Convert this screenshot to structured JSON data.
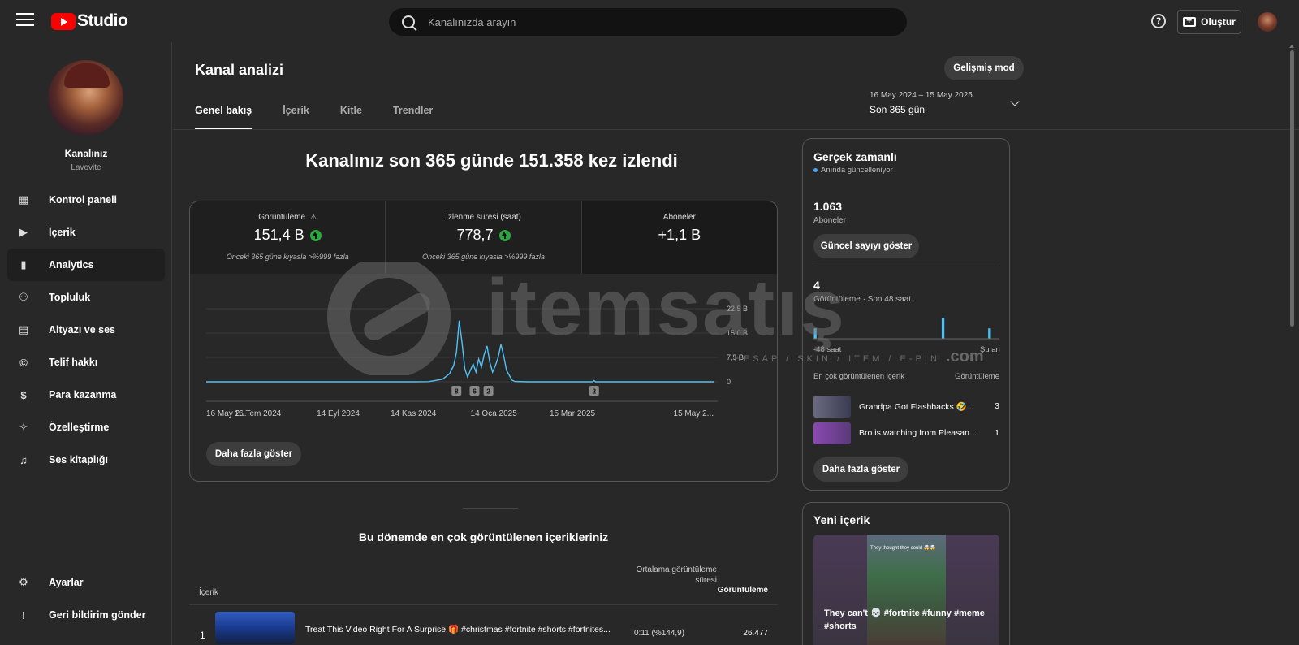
{
  "app": {
    "logo_text": "Studio"
  },
  "search": {
    "placeholder": "Kanalınızda arayın"
  },
  "header": {
    "help_glyph": "?",
    "create_label": "Oluştur"
  },
  "channel": {
    "name": "Kanalınız",
    "handle": "Lavovite"
  },
  "sidebar": {
    "items": [
      {
        "label": "Kontrol paneli",
        "icon": "dashboard-icon",
        "glyph": "▦"
      },
      {
        "label": "İçerik",
        "icon": "content-icon",
        "glyph": "▶"
      },
      {
        "label": "Analytics",
        "icon": "analytics-icon",
        "glyph": "▮",
        "active": true
      },
      {
        "label": "Topluluk",
        "icon": "community-icon",
        "glyph": "⚇"
      },
      {
        "label": "Altyazı ve ses",
        "icon": "subtitles-icon",
        "glyph": "▤"
      },
      {
        "label": "Telif hakkı",
        "icon": "copyright-icon",
        "glyph": "©"
      },
      {
        "label": "Para kazanma",
        "icon": "monetization-icon",
        "glyph": "$"
      },
      {
        "label": "Özelleştirme",
        "icon": "customization-icon",
        "glyph": "✧"
      },
      {
        "label": "Ses kitaplığı",
        "icon": "audio-library-icon",
        "glyph": "♫"
      }
    ],
    "bottom": [
      {
        "label": "Ayarlar",
        "icon": "settings-icon",
        "glyph": "⚙"
      },
      {
        "label": "Geri bildirim gönder",
        "icon": "feedback-icon",
        "glyph": "!"
      }
    ]
  },
  "page": {
    "title": "Kanal analizi",
    "advanced_mode": "Gelişmiş mod",
    "tabs": [
      {
        "label": "Genel bakış",
        "active": true
      },
      {
        "label": "İçerik"
      },
      {
        "label": "Kitle"
      },
      {
        "label": "Trendler"
      }
    ],
    "date_range": {
      "dates": "16 May 2024 – 15 May 2025",
      "label": "Son 365 gün"
    },
    "headline": "Kanalınız son 365 günde 151.358 kez izlendi"
  },
  "metrics": {
    "views": {
      "label": "Görüntüleme",
      "value": "151,4 B",
      "note": "Önceki 365 güne kıyasla >%999 fazla",
      "warning_glyph": "⚠"
    },
    "watch_time": {
      "label": "İzlenme süresi (saat)",
      "value": "778,7",
      "note": "Önceki 365 güne kıyasla >%999 fazla"
    },
    "subscribers": {
      "label": "Aboneler",
      "value": "+1,1 B"
    }
  },
  "chart_data": {
    "type": "line",
    "y_ticks": [
      "22,5 B",
      "15,0 B",
      "7,5 B",
      "0"
    ],
    "ylim": [
      0,
      22500
    ],
    "x_ticks": [
      "16 May 2...",
      "16 Tem 2024",
      "14 Eyl 2024",
      "14 Kas 2024",
      "14 Oca 2025",
      "15 Mar 2025",
      "15 May 2..."
    ],
    "series": [
      {
        "color": "#4fc3f7",
        "points": [
          [
            0,
            0
          ],
          [
            150,
            0
          ],
          [
            160,
            50
          ],
          [
            170,
            800
          ],
          [
            175,
            2500
          ],
          [
            178,
            5000
          ],
          [
            180,
            9000
          ],
          [
            182,
            18800
          ],
          [
            184,
            12000
          ],
          [
            186,
            4000
          ],
          [
            188,
            1500
          ],
          [
            190,
            3500
          ],
          [
            192,
            5500
          ],
          [
            194,
            3000
          ],
          [
            196,
            7000
          ],
          [
            198,
            4500
          ],
          [
            200,
            8500
          ],
          [
            202,
            11000
          ],
          [
            204,
            6000
          ],
          [
            206,
            3000
          ],
          [
            208,
            5000
          ],
          [
            210,
            7500
          ],
          [
            212,
            11500
          ],
          [
            214,
            8000
          ],
          [
            216,
            3500
          ],
          [
            218,
            2000
          ],
          [
            220,
            500
          ],
          [
            222,
            100
          ],
          [
            232,
            0
          ],
          [
            278,
            0
          ],
          [
            279,
            400
          ],
          [
            280,
            0
          ],
          [
            365,
            0
          ]
        ]
      }
    ],
    "annotations": [
      {
        "x": 180,
        "label": "8"
      },
      {
        "x": 193,
        "label": "6"
      },
      {
        "x": 203,
        "label": "2"
      },
      {
        "x": 279,
        "label": "2"
      }
    ],
    "grid": true
  },
  "overview_more": "Daha fazla göster",
  "top_content": {
    "title": "Bu dönemde en çok görüntülenen içerikleriniz",
    "headers": {
      "content": "İçerik",
      "avg_duration": "Ortalama görüntüleme süresi",
      "views": "Görüntüleme"
    },
    "rows": [
      {
        "rank": "1",
        "title": "Treat This Video Right For A Surprise 🎁 #christmas #fortnite #shorts #fortnites...",
        "avg": "0:11   (%144,9)",
        "views": "26.477"
      }
    ]
  },
  "realtime": {
    "title": "Gerçek zamanlı",
    "live_text": "Anında güncelleniyor",
    "subscribers_value": "1.063",
    "subscribers_label": "Aboneler",
    "show_count": "Güncel sayıyı göster",
    "views_value": "4",
    "views_label": "Görüntüleme · Son 48 saat",
    "bars": [
      1,
      0,
      0,
      0,
      0,
      0,
      0,
      0,
      0,
      0,
      0,
      0,
      0,
      0,
      0,
      0,
      0,
      0,
      0,
      0,
      0,
      0,
      0,
      0,
      0,
      0,
      0,
      0,
      0,
      0,
      0,
      0,
      0,
      2,
      0,
      0,
      0,
      0,
      0,
      0,
      0,
      0,
      0,
      0,
      0,
      1,
      0,
      0
    ],
    "axis_left": "-48 saat",
    "axis_right": "Şu an",
    "top_header": "En çok görüntülenen içerik",
    "top_views_header": "Görüntüleme",
    "items": [
      {
        "title": "Grandpa Got Flashbacks 🤣...",
        "views": "3",
        "thumb": "#5a5a6a"
      },
      {
        "title": "Bro is watching from Pleasan...",
        "views": "1",
        "thumb": "#7a4a8a"
      }
    ],
    "more": "Daha fazla göster"
  },
  "new_content": {
    "title": "Yeni içerik",
    "thumb_caption": "They thought they could 🤯🤯",
    "video_title": "They can't 💀 #fortnite #funny #meme #shorts"
  },
  "watermark": {
    "text": "itemsatış",
    "sub": "HESAP / SKIN / ITEM / E-PIN",
    "dotcom": ".com"
  }
}
